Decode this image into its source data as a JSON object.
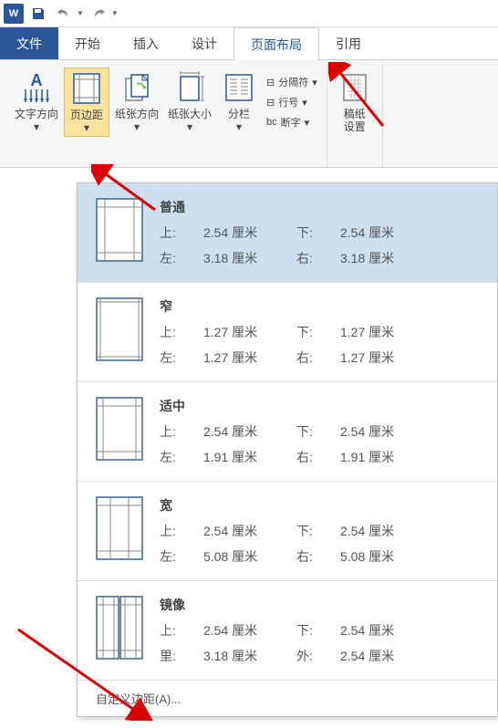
{
  "tabs": {
    "file": "文件",
    "home": "开始",
    "insert": "插入",
    "design": "设计",
    "layout": "页面布局",
    "references": "引用"
  },
  "ribbon": {
    "text_direction": "文字方向",
    "margins": "页边距",
    "orientation": "纸张方向",
    "size": "纸张大小",
    "columns": "分栏",
    "breaks": "分隔符",
    "line_numbers": "行号",
    "hyphenation": "断字",
    "manuscript": "稿纸",
    "manuscript_settings": "设置"
  },
  "margin_presets": [
    {
      "name": "普通",
      "label_top": "上:",
      "val_top": "2.54 厘米",
      "label_bottom": "下:",
      "val_bottom": "2.54 厘米",
      "label_left": "左:",
      "val_left": "3.18 厘米",
      "label_right": "右:",
      "val_right": "3.18 厘米",
      "selected": true,
      "preview_type": "normal"
    },
    {
      "name": "窄",
      "label_top": "上:",
      "val_top": "1.27 厘米",
      "label_bottom": "下:",
      "val_bottom": "1.27 厘米",
      "label_left": "左:",
      "val_left": "1.27 厘米",
      "label_right": "右:",
      "val_right": "1.27 厘米",
      "selected": false,
      "preview_type": "narrow"
    },
    {
      "name": "适中",
      "label_top": "上:",
      "val_top": "2.54 厘米",
      "label_bottom": "下:",
      "val_bottom": "2.54 厘米",
      "label_left": "左:",
      "val_left": "1.91 厘米",
      "label_right": "右:",
      "val_right": "1.91 厘米",
      "selected": false,
      "preview_type": "moderate"
    },
    {
      "name": "宽",
      "label_top": "上:",
      "val_top": "2.54 厘米",
      "label_bottom": "下:",
      "val_bottom": "2.54 厘米",
      "label_left": "左:",
      "val_left": "5.08 厘米",
      "label_right": "右:",
      "val_right": "5.08 厘米",
      "selected": false,
      "preview_type": "wide"
    },
    {
      "name": "镜像",
      "label_top": "上:",
      "val_top": "2.54 厘米",
      "label_bottom": "下:",
      "val_bottom": "2.54 厘米",
      "label_left": "里:",
      "val_left": "3.18 厘米",
      "label_right": "外:",
      "val_right": "2.54 厘米",
      "selected": false,
      "preview_type": "mirror"
    }
  ],
  "custom_margins_label": "自定义边距(A)..."
}
